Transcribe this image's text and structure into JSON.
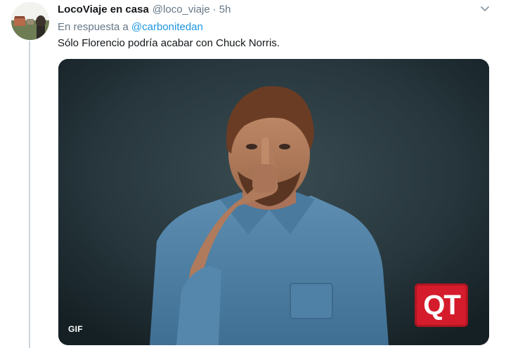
{
  "tweet": {
    "display_name": "LocoViaje en casa",
    "handle": "@loco_viaje",
    "separator": "·",
    "time": "5h",
    "reply_prefix": "En respuesta a",
    "reply_mention": "@carbonitedan",
    "text": "Sólo Florencio podría acabar con Chuck Norris.",
    "media": {
      "badge": "GIF",
      "logo_text": "QT"
    }
  },
  "colors": {
    "link": "#1b95e0",
    "secondary_text": "#657786",
    "primary_text": "#14171a",
    "thread_line": "#ccd6dd",
    "qt_red": "#d41c2c"
  },
  "icons": {
    "caret": "chevron-down-icon"
  }
}
